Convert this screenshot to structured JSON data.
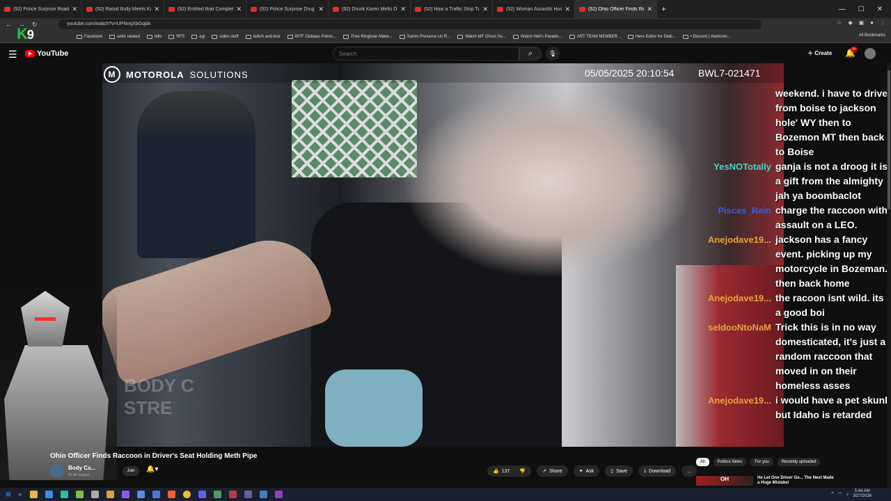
{
  "browser": {
    "tabs": [
      {
        "title": "(52) Police Surprise Road Rage",
        "active": false
      },
      {
        "title": "(52) Racist Bully Meets Karma",
        "active": false
      },
      {
        "title": "(52) Entitled Brat Completely L",
        "active": false
      },
      {
        "title": "(52) Police Surprise Drug Dealer",
        "active": false
      },
      {
        "title": "(52) Drunk Karen Melts Down a",
        "active": false
      },
      {
        "title": "(52) How a Traffic Stop Turned",
        "active": false
      },
      {
        "title": "(52) Woman Assaults Husband",
        "active": false
      },
      {
        "title": "(52) Ohio Officer Finds Ra",
        "active": true
      }
    ],
    "url": "youtube.com/watch?v=UPNmjXbGqdA",
    "bookmarks": [
      "Facebook",
      "work related",
      "bills",
      "RFS",
      "egl",
      "video stuff",
      "twitch and kick",
      "WTF Outlaws Points...",
      "Free Ringtone Make...",
      "Saints Preserve Us R...",
      "Watch MF Ghost Se...",
      "Watch Hell's Paradis...",
      "ART TEAM MEMBER...",
      "Hero Editor for Diab...",
      "• Discord | #welcom..."
    ],
    "all_bookmarks_label": "All Bookmarks"
  },
  "overlay": {
    "logo_letter": "K",
    "logo_number": "9"
  },
  "youtube": {
    "logo_text": "YouTube",
    "search_placeholder": "Search",
    "create_label": "Create",
    "notif_badge": "9+"
  },
  "video": {
    "brand_bold": "MOTOROLA",
    "brand_light": "SOLUTIONS",
    "timestamp": "05/05/2025 20:10:54",
    "device_id": "BWL7-021471",
    "ghost_text_1": "BODY C",
    "ghost_text_2": "STRE"
  },
  "chat": [
    {
      "user": "",
      "color": "#ffffff",
      "text": "weekend. i have to drive from boise to jackson hole' WY then to Bozemon MT then back to Boise"
    },
    {
      "user": "YesNOTotally",
      "color": "#4fd1c5",
      "text": "ganja is not a droog it is a gift from the almighty jah ya boombaclot"
    },
    {
      "user": "Pisces_Rain",
      "color": "#3b5bd6",
      "text": "charge the raccoon with assault on a LEO."
    },
    {
      "user": "Anejodave19...",
      "color": "#e8a33a",
      "text": "jackson has a fancy event. picking up my motorcycle in Bozeman. then back home"
    },
    {
      "user": "Anejodave19...",
      "color": "#e8a33a",
      "text": "the racoon isnt wild. its a good boi"
    },
    {
      "user": "seldooNtoNaM",
      "color": "#e8a33a",
      "text": "Trick this is in no way domesticated, it's just a random raccoon that moved in on their homeless asses"
    },
    {
      "user": "Anejodave19...",
      "color": "#e8a33a",
      "text": "i would have a pet skunk but Idaho is retarded"
    }
  ],
  "below_video": {
    "title": "Ohio Officer Finds Raccoon in Driver's Seat Holding Meth Pipe",
    "channel_name": "Body Ca...",
    "channel_subs": "81.9K subscri...",
    "join_label": "Join",
    "likes": "137",
    "share_label": "Share",
    "ask_label": "Ask",
    "save_label": "Save",
    "download_label": "Download",
    "more_label": "..."
  },
  "sidebar": {
    "chips": [
      "All",
      "Politics News",
      "For you",
      "Recently uploaded"
    ],
    "rec_thumb_text": "OH",
    "rec_title": "He Let One Driver Go... The Next Made a Huge Mistake!"
  },
  "taskbar": {
    "time": "5:44 AM",
    "date": "3/27/2026"
  }
}
